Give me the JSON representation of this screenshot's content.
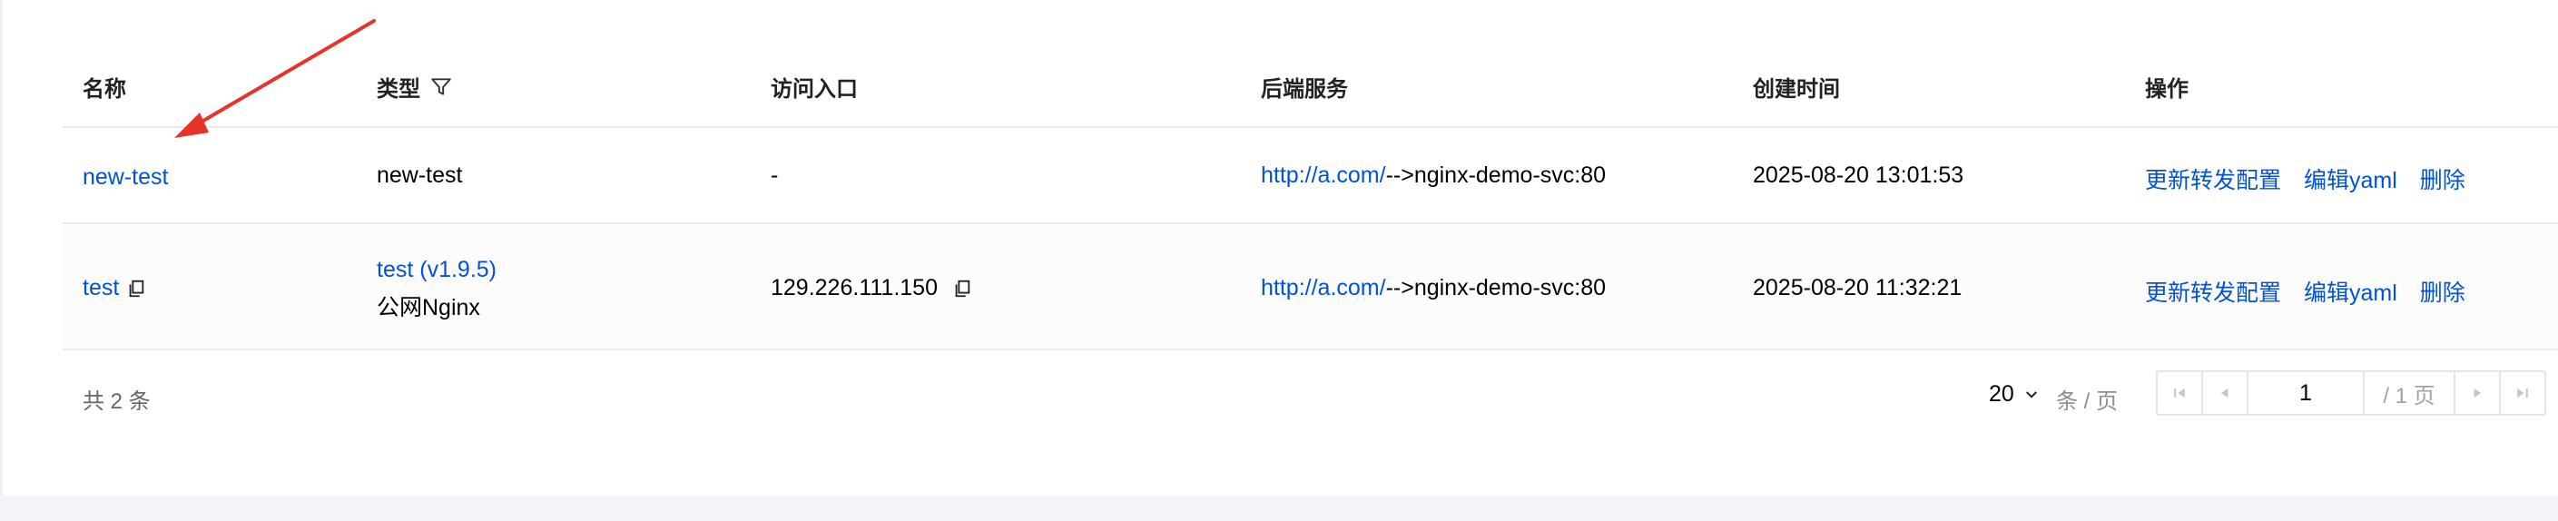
{
  "columns": {
    "name": "名称",
    "type": "类型",
    "entry": "访问入口",
    "backend": "后端服务",
    "created": "创建时间",
    "actions": "操作"
  },
  "rows": [
    {
      "name": "new-test",
      "type": "new-test",
      "type_sub": "",
      "entry": "-",
      "backend_link": "http://a.com/",
      "backend_rest": "-->nginx-demo-svc:80",
      "created": "2025-08-20 13:01:53",
      "actions": [
        "更新转发配置",
        "编辑yaml",
        "删除"
      ]
    },
    {
      "name": "test",
      "type": "test (v1.9.5)",
      "type_sub": "公网Nginx",
      "entry": "129.226.111.150",
      "backend_link": "http://a.com/",
      "backend_rest": "-->nginx-demo-svc:80",
      "created": "2025-08-20 11:32:21",
      "actions": [
        "更新转发配置",
        "编辑yaml",
        "删除"
      ]
    }
  ],
  "footer": {
    "total": "共 2 条",
    "page_size": "20",
    "per_page_label": "条 / 页",
    "current_page": "1",
    "total_pages": "/ 1 页"
  },
  "icons": {
    "filter": "filter-icon",
    "copy": "copy-icon",
    "first": "first-page-icon",
    "prev": "prev-page-icon",
    "next": "next-page-icon",
    "last": "last-page-icon",
    "dropdown": "chevron-down-icon"
  },
  "colors": {
    "link": "#0052d9",
    "annotation_arrow": "#e8332c",
    "border": "#e7e9ee",
    "background": "#f3f4f7"
  }
}
